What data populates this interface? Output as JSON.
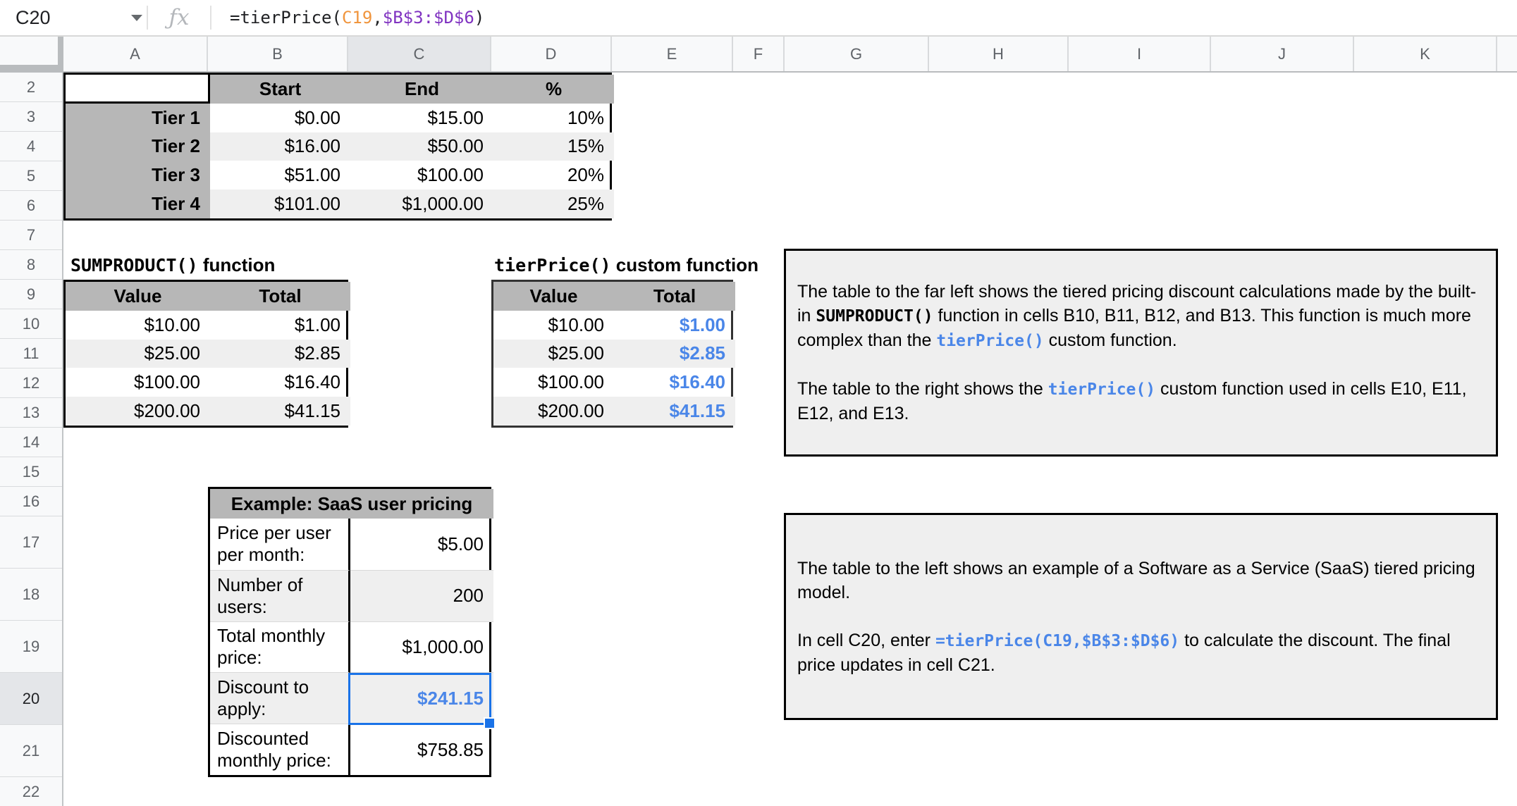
{
  "formula_bar": {
    "cell_ref": "C20",
    "fx_label": "ƒx",
    "formula": {
      "prefix": "=tierPrice(",
      "arg1": "C19",
      "comma": ",",
      "arg2": "$B$3:$D$6",
      "suffix": ")"
    }
  },
  "colors": {
    "accent_blue_values": "#4a86e8",
    "selection_blue": "#1a73e8",
    "formula_ref_orange": "#f0953d",
    "formula_ref_purple": "#8033c1",
    "table_header_gray": "#b7b7b7",
    "alt_row_gray": "#efefef",
    "note_background": "#efefef"
  },
  "column_headers": [
    "A",
    "B",
    "C",
    "D",
    "E",
    "F",
    "G",
    "H",
    "I",
    "J",
    "K",
    ""
  ],
  "row_headers": [
    "2",
    "3",
    "4",
    "5",
    "6",
    "7",
    "8",
    "9",
    "10",
    "11",
    "12",
    "13",
    "14",
    "15",
    "16",
    "17",
    "18",
    "19",
    "20",
    "21",
    "22"
  ],
  "tier_table": {
    "headers": [
      "Start",
      "End",
      "%"
    ],
    "rows": [
      {
        "label": "Tier 1",
        "start": "$0.00",
        "end": "$15.00",
        "pct": "10%"
      },
      {
        "label": "Tier 2",
        "start": "$16.00",
        "end": "$50.00",
        "pct": "15%"
      },
      {
        "label": "Tier 3",
        "start": "$51.00",
        "end": "$100.00",
        "pct": "20%"
      },
      {
        "label": "Tier 4",
        "start": "$101.00",
        "end": "$1,000.00",
        "pct": "25%"
      }
    ]
  },
  "sumproduct_section": {
    "title_mono": "SUMPRODUCT()",
    "title_rest": " function",
    "headers": [
      "Value",
      "Total"
    ],
    "rows": [
      {
        "value": "$10.00",
        "total": "$1.00"
      },
      {
        "value": "$25.00",
        "total": "$2.85"
      },
      {
        "value": "$100.00",
        "total": "$16.40"
      },
      {
        "value": "$200.00",
        "total": "$41.15"
      }
    ]
  },
  "tierprice_section": {
    "title_mono": "tierPrice()",
    "title_rest": " custom function",
    "headers": [
      "Value",
      "Total"
    ],
    "rows": [
      {
        "value": "$10.00",
        "total": "$1.00"
      },
      {
        "value": "$25.00",
        "total": "$2.85"
      },
      {
        "value": "$100.00",
        "total": "$16.40"
      },
      {
        "value": "$200.00",
        "total": "$41.15"
      }
    ]
  },
  "saas_table": {
    "title": "Example: SaaS user pricing",
    "rows": [
      {
        "label": "Price per user per month:",
        "value": "$5.00"
      },
      {
        "label": "Number of users:",
        "value": "200"
      },
      {
        "label": "Total monthly price:",
        "value": "$1,000.00"
      },
      {
        "label": "Discount to apply:",
        "value": "$241.15"
      },
      {
        "label": "Discounted monthly price:",
        "value": "$758.85"
      }
    ]
  },
  "note1": {
    "p1_s1": "The table to the far left shows the tiered pricing discount calculations made by the built-in ",
    "p1_m1": "SUMPRODUCT()",
    "p1_s2": " function in cells B10, B11, B12, and B13. This function is much more complex than the ",
    "p1_m2": "tierPrice()",
    "p1_s3": " custom function.",
    "p2_s1": "The table to the right shows the ",
    "p2_m1": "tierPrice()",
    "p2_s2": " custom function used in cells E10, E11, E12, and E13."
  },
  "note2": {
    "p1": "The table to the left shows an example of a Software as a Service (SaaS) tiered pricing model.",
    "p2_s1": "In cell C20, enter ",
    "p2_m1": "=tierPrice(C19,$B$3:$D$6)",
    "p2_s2": " to calculate the discount. The final price updates in cell C21."
  }
}
